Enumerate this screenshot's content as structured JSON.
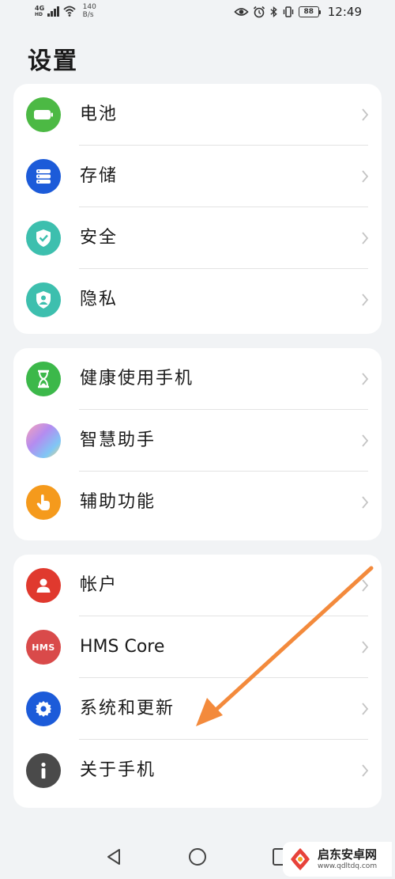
{
  "status_bar": {
    "network": "4G",
    "network_sub": "HD",
    "speed_value": "140",
    "speed_unit": "B/s",
    "battery": "88",
    "time": "12:49"
  },
  "page": {
    "title": "设置"
  },
  "groups": [
    {
      "items": [
        {
          "label": "电池",
          "icon": "battery-icon",
          "color": "#4cb944"
        },
        {
          "label": "存储",
          "icon": "storage-icon",
          "color": "#1c5bd9"
        },
        {
          "label": "安全",
          "icon": "security-shield-icon",
          "color": "#3dbfae"
        },
        {
          "label": "隐私",
          "icon": "privacy-icon",
          "color": "#3dbfae"
        }
      ]
    },
    {
      "items": [
        {
          "label": "健康使用手机",
          "icon": "hourglass-icon",
          "color": "#3cb84a"
        },
        {
          "label": "智慧助手",
          "icon": "smart-assistant-icon",
          "color": "#b48cf0"
        },
        {
          "label": "辅助功能",
          "icon": "accessibility-hand-icon",
          "color": "#f59a1c"
        }
      ]
    },
    {
      "items": [
        {
          "label": "帐户",
          "icon": "account-icon",
          "color": "#e0392e"
        },
        {
          "label": "HMS Core",
          "icon": "hms-core-icon",
          "color": "#d94a4a",
          "badge": "HMS"
        },
        {
          "label": "系统和更新",
          "icon": "gear-icon",
          "color": "#1c5bd9"
        },
        {
          "label": "关于手机",
          "icon": "info-icon",
          "color": "#4a4a4a"
        }
      ]
    }
  ],
  "nav": {
    "back": "back-icon",
    "home": "home-icon",
    "recents": "recents-icon"
  },
  "watermark": {
    "name": "启东安卓网",
    "url": "www.qdltdq.com"
  },
  "annotation": {
    "arrow_color": "#f38a3c"
  }
}
